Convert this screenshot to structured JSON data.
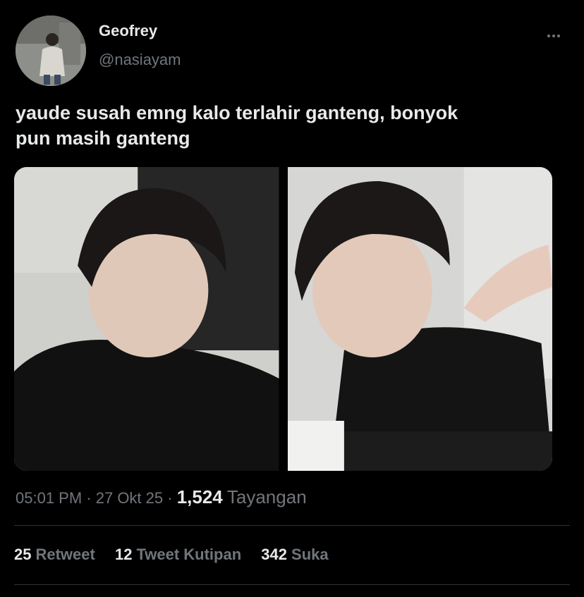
{
  "author": {
    "name": "Geofrey",
    "handle": "@nasiayam"
  },
  "tweet": {
    "text_line1": "yaude susah emng kalo terlahir ganteng, bonyok",
    "text_line2": "pun masih ganteng"
  },
  "meta": {
    "time": "05:01 PM",
    "sep1": " · ",
    "date": "27 Okt 25",
    "sep2": " · ",
    "views_count": "1,524",
    "views_label": "Tayangan"
  },
  "stats": {
    "retweets_count": "25",
    "retweets_label": "Retweet",
    "quotes_count": "12",
    "quotes_label": "Tweet Kutipan",
    "likes_count": "342",
    "likes_label": "Suka"
  },
  "colors": {
    "background": "#000000",
    "text_primary": "#e7e9ea",
    "text_secondary": "#71767b",
    "divider": "#2f3336"
  },
  "icons": {
    "more": "more-horizontal-icon"
  }
}
